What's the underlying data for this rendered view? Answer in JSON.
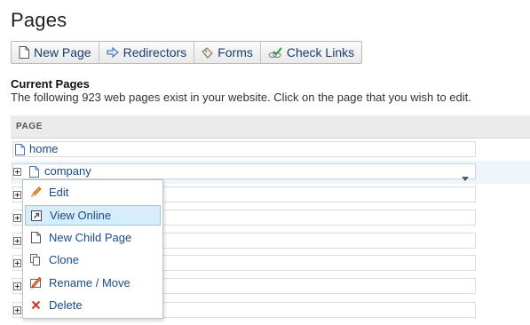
{
  "page": {
    "title": "Pages"
  },
  "toolbar": {
    "buttons": [
      {
        "label": "New Page",
        "icon": "document-icon"
      },
      {
        "label": "Redirectors",
        "icon": "arrow-right-icon"
      },
      {
        "label": "Forms",
        "icon": "tag-icon"
      },
      {
        "label": "Check Links",
        "icon": "check-links-icon"
      }
    ]
  },
  "section": {
    "heading": "Current Pages",
    "description": "The following 923 web pages exist in your website. Click on the page that you wish to edit."
  },
  "table": {
    "column_header": "PAGE",
    "rows": [
      {
        "label": "home",
        "expandable": false,
        "highlighted": false
      },
      {
        "label": "company",
        "expandable": true,
        "highlighted": true
      },
      {
        "label": "",
        "expandable": true
      },
      {
        "label": "",
        "expandable": true
      },
      {
        "label": "",
        "expandable": true
      },
      {
        "label": "",
        "expandable": true
      },
      {
        "label": "",
        "expandable": true
      },
      {
        "label": "",
        "expandable": true
      }
    ]
  },
  "context_menu": {
    "items": [
      {
        "label": "Edit",
        "icon": "pencil-icon",
        "active": false
      },
      {
        "label": "View Online",
        "icon": "external-link-icon",
        "active": true
      },
      {
        "label": "New Child Page",
        "icon": "document-icon",
        "active": false
      },
      {
        "label": "Clone",
        "icon": "copy-icon",
        "active": false
      },
      {
        "label": "Rename / Move",
        "icon": "rename-icon",
        "active": false
      },
      {
        "label": "Delete",
        "icon": "delete-x-icon",
        "active": false
      }
    ]
  },
  "colors": {
    "link": "#1a4a8a",
    "highlight_row": "#eef5fb",
    "menu_active": "#d9ecfa",
    "delete": "#d0322a"
  }
}
